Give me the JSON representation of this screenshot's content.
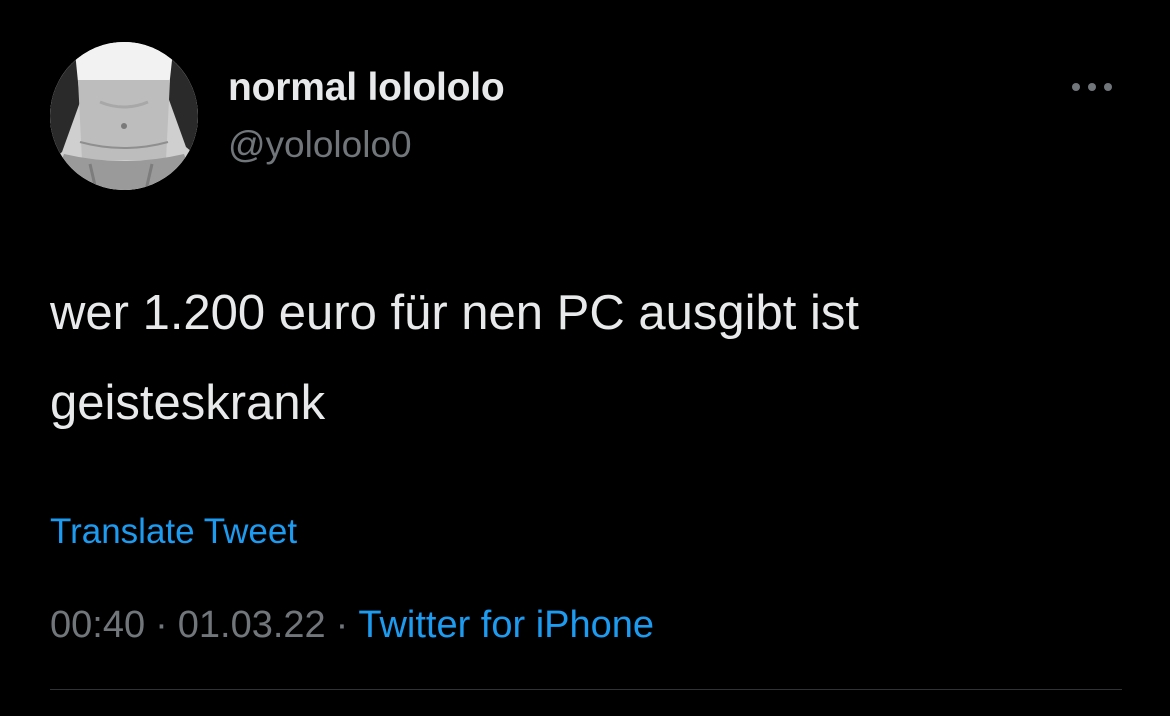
{
  "user": {
    "display_name": "normal lolololo",
    "handle": "@yolololo0"
  },
  "tweet": {
    "text": "wer 1.200 euro für nen PC ausgibt ist geisteskrank",
    "translate_label": "Translate Tweet",
    "time": "00:40",
    "date": "01.03.22",
    "separator": "·",
    "source": "Twitter for iPhone"
  },
  "colors": {
    "background": "#000000",
    "primary_text": "#e7e9ea",
    "secondary_text": "#71767b",
    "accent": "#1d9bf0",
    "divider": "#2f3336"
  },
  "icons": {
    "more": "more-horizontal-icon"
  }
}
